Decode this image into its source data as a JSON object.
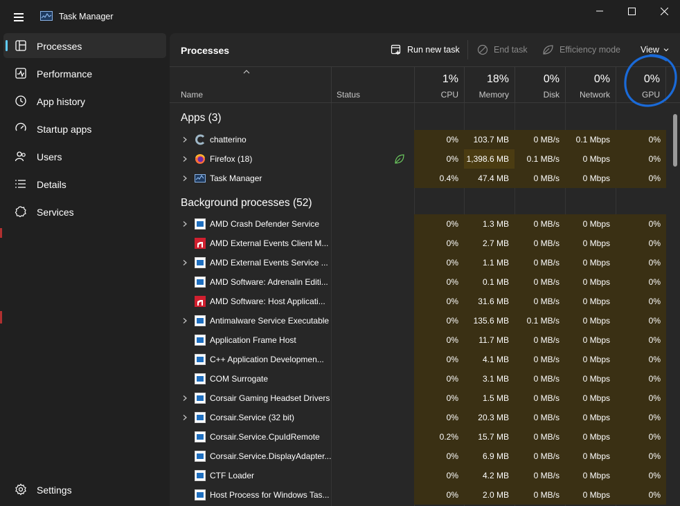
{
  "app": {
    "title": "Task Manager"
  },
  "nav": [
    {
      "label": "Processes",
      "icon": "processes-icon",
      "active": true
    },
    {
      "label": "Performance",
      "icon": "performance-icon"
    },
    {
      "label": "App history",
      "icon": "history-icon"
    },
    {
      "label": "Startup apps",
      "icon": "startup-icon"
    },
    {
      "label": "Users",
      "icon": "users-icon"
    },
    {
      "label": "Details",
      "icon": "details-icon"
    },
    {
      "label": "Services",
      "icon": "services-icon"
    }
  ],
  "settings": {
    "label": "Settings",
    "icon": "gear-icon"
  },
  "toolbar": {
    "title": "Processes",
    "run_new_task": "Run new task",
    "end_task": "End task",
    "efficiency_mode": "Efficiency mode",
    "view": "View"
  },
  "columns": {
    "name": "Name",
    "status": "Status",
    "cpu": {
      "pct": "1%",
      "label": "CPU"
    },
    "memory": {
      "pct": "18%",
      "label": "Memory"
    },
    "disk": {
      "pct": "0%",
      "label": "Disk"
    },
    "network": {
      "pct": "0%",
      "label": "Network"
    },
    "gpu": {
      "pct": "0%",
      "label": "GPU"
    }
  },
  "groups": {
    "apps": "Apps (3)",
    "background": "Background processes (52)"
  },
  "apps": [
    {
      "name": "chatterino",
      "cpu": "0%",
      "mem": "103.7 MB",
      "disk": "0 MB/s",
      "net": "0.1 Mbps",
      "gpu": "0%"
    },
    {
      "name": "Firefox (18)",
      "cpu": "0%",
      "mem": "1,398.6 MB",
      "disk": "0.1 MB/s",
      "net": "0 Mbps",
      "gpu": "0%"
    },
    {
      "name": "Task Manager",
      "cpu": "0.4%",
      "mem": "47.4 MB",
      "disk": "0 MB/s",
      "net": "0 Mbps",
      "gpu": "0%"
    }
  ],
  "background": [
    {
      "name": "AMD Crash Defender Service",
      "cpu": "0%",
      "mem": "1.3 MB",
      "disk": "0 MB/s",
      "net": "0 Mbps",
      "gpu": "0%"
    },
    {
      "name": "AMD External Events Client M...",
      "cpu": "0%",
      "mem": "2.7 MB",
      "disk": "0 MB/s",
      "net": "0 Mbps",
      "gpu": "0%"
    },
    {
      "name": "AMD External Events Service ...",
      "cpu": "0%",
      "mem": "1.1 MB",
      "disk": "0 MB/s",
      "net": "0 Mbps",
      "gpu": "0%"
    },
    {
      "name": "AMD Software: Adrenalin Editi...",
      "cpu": "0%",
      "mem": "0.1 MB",
      "disk": "0 MB/s",
      "net": "0 Mbps",
      "gpu": "0%"
    },
    {
      "name": "AMD Software: Host Applicati...",
      "cpu": "0%",
      "mem": "31.6 MB",
      "disk": "0 MB/s",
      "net": "0 Mbps",
      "gpu": "0%"
    },
    {
      "name": "Antimalware Service Executable",
      "cpu": "0%",
      "mem": "135.6 MB",
      "disk": "0.1 MB/s",
      "net": "0 Mbps",
      "gpu": "0%"
    },
    {
      "name": "Application Frame Host",
      "cpu": "0%",
      "mem": "11.7 MB",
      "disk": "0 MB/s",
      "net": "0 Mbps",
      "gpu": "0%"
    },
    {
      "name": "C++ Application Developmen...",
      "cpu": "0%",
      "mem": "4.1 MB",
      "disk": "0 MB/s",
      "net": "0 Mbps",
      "gpu": "0%"
    },
    {
      "name": "COM Surrogate",
      "cpu": "0%",
      "mem": "3.1 MB",
      "disk": "0 MB/s",
      "net": "0 Mbps",
      "gpu": "0%"
    },
    {
      "name": "Corsair Gaming Headset Drivers",
      "cpu": "0%",
      "mem": "1.5 MB",
      "disk": "0 MB/s",
      "net": "0 Mbps",
      "gpu": "0%"
    },
    {
      "name": "Corsair.Service (32 bit)",
      "cpu": "0%",
      "mem": "20.3 MB",
      "disk": "0 MB/s",
      "net": "0 Mbps",
      "gpu": "0%"
    },
    {
      "name": "Corsair.Service.CpuIdRemote",
      "cpu": "0.2%",
      "mem": "15.7 MB",
      "disk": "0 MB/s",
      "net": "0 Mbps",
      "gpu": "0%"
    },
    {
      "name": "Corsair.Service.DisplayAdapter...",
      "cpu": "0%",
      "mem": "6.9 MB",
      "disk": "0 MB/s",
      "net": "0 Mbps",
      "gpu": "0%"
    },
    {
      "name": "CTF Loader",
      "cpu": "0%",
      "mem": "4.2 MB",
      "disk": "0 MB/s",
      "net": "0 Mbps",
      "gpu": "0%"
    },
    {
      "name": "Host Process for Windows Tas...",
      "cpu": "0%",
      "mem": "2.0 MB",
      "disk": "0 MB/s",
      "net": "0 Mbps",
      "gpu": "0%"
    }
  ],
  "colors": {
    "accent": "#60cdff",
    "heat": "#3a3014",
    "annotation": "#1a6ad8"
  }
}
